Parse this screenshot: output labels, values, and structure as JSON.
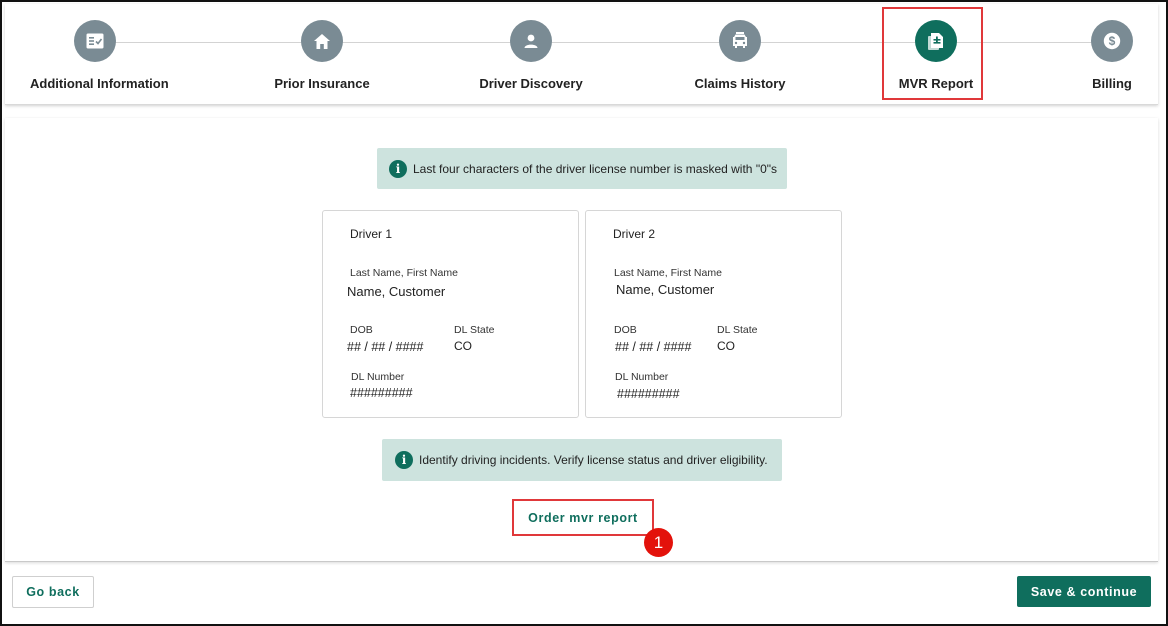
{
  "stepper": {
    "steps": [
      {
        "label": "Additional Information",
        "icon": "checklist-icon"
      },
      {
        "label": "Prior Insurance",
        "icon": "home-icon"
      },
      {
        "label": "Driver Discovery",
        "icon": "person-icon"
      },
      {
        "label": "Claims History",
        "icon": "car-icon"
      },
      {
        "label": "MVR Report",
        "icon": "document-icon",
        "active": true
      },
      {
        "label": "Billing",
        "icon": "dollar-icon"
      }
    ]
  },
  "main": {
    "mask_notice": "Last four characters of the driver license number is masked with \"0\"s",
    "incidents_notice": "Identify driving incidents. Verify license status and driver eligibility.",
    "drivers": [
      {
        "title": "Driver 1",
        "name_label": "Last Name, First Name",
        "name": "Name, Customer",
        "dob_label": "DOB",
        "dob": "## / ## / ####",
        "state_label": "DL State",
        "state": "CO",
        "dl_label": "DL Number",
        "dl_number": "#########"
      },
      {
        "title": "Driver 2",
        "name_label": "Last Name, First Name",
        "name": "Name, Customer",
        "dob_label": "DOB",
        "dob": "## / ## / ####",
        "state_label": "DL State",
        "state": "CO",
        "dl_label": "DL Number",
        "dl_number": "#########"
      }
    ],
    "order_button": "Order mvr report",
    "callout_number": "1"
  },
  "footer": {
    "back_label": "Go back",
    "save_label": "Save & continue"
  },
  "colors": {
    "accent": "#0f6e5d",
    "inactive_step": "#7a8b94",
    "info_bg": "#cde3de",
    "highlight": "#e0383a"
  }
}
